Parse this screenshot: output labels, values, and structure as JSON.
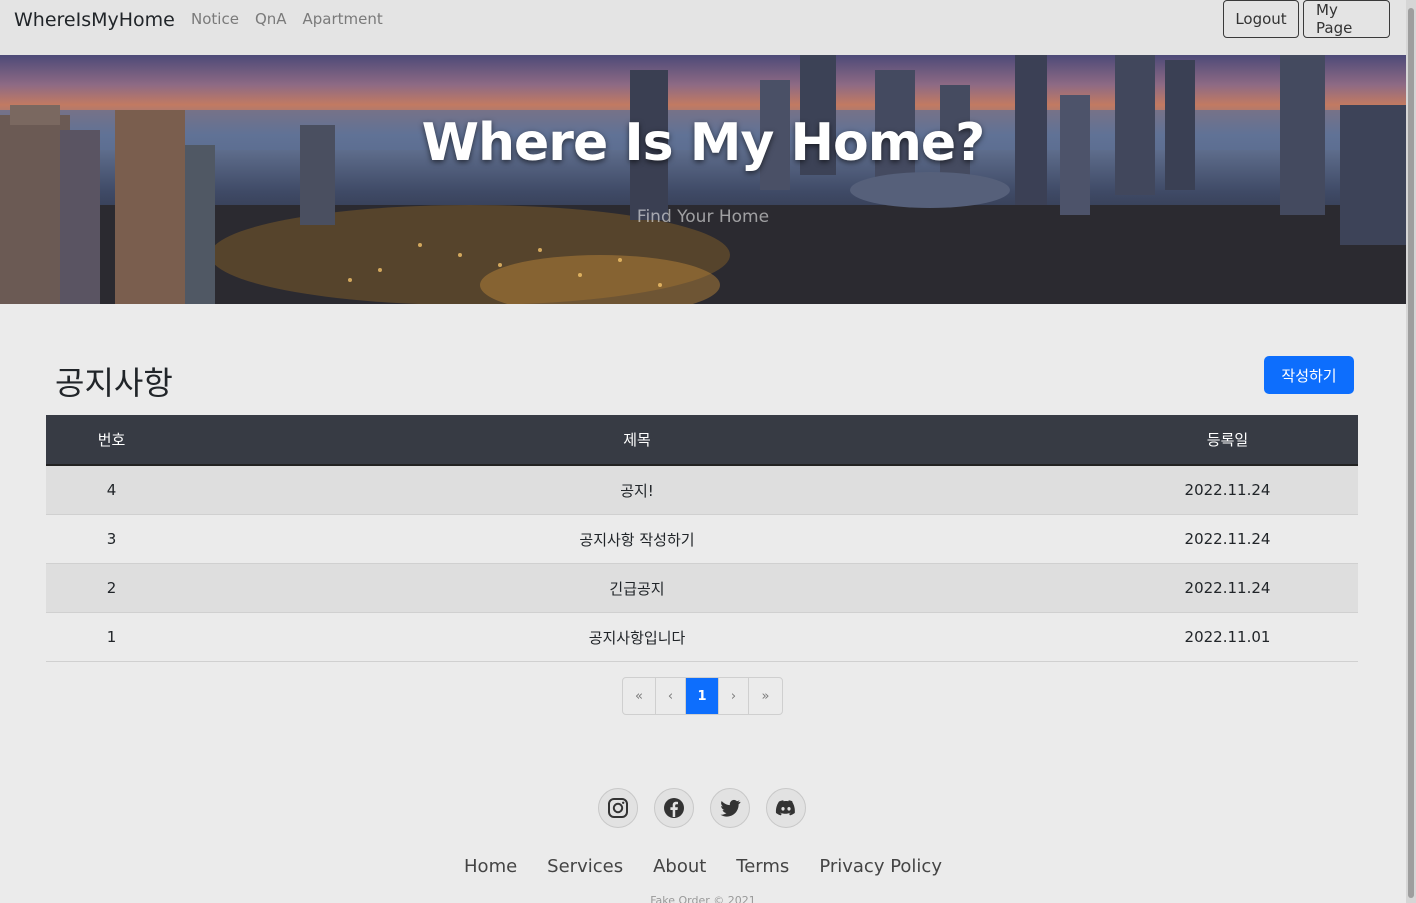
{
  "navbar": {
    "brand": "WhereIsMyHome",
    "links": [
      "Notice",
      "QnA",
      "Apartment"
    ],
    "logout_label": "Logout",
    "mypage_label": "My Page"
  },
  "hero": {
    "title": "Where Is My Home?",
    "subtitle": "Find Your Home"
  },
  "notice": {
    "heading": "공지사항",
    "write_label": "작성하기",
    "columns": [
      "번호",
      "제목",
      "등록일"
    ],
    "rows": [
      {
        "no": "4",
        "title": "공지!",
        "date": "2022.11.24"
      },
      {
        "no": "3",
        "title": "공지사항 작성하기",
        "date": "2022.11.24"
      },
      {
        "no": "2",
        "title": "긴급공지",
        "date": "2022.11.24"
      },
      {
        "no": "1",
        "title": "공지사항입니다",
        "date": "2022.11.01"
      }
    ]
  },
  "pagination": {
    "first": "«",
    "prev": "‹",
    "current": "1",
    "next": "›",
    "last": "»"
  },
  "footer": {
    "social_icons": [
      "instagram-icon",
      "facebook-icon",
      "twitter-icon",
      "discord-icon"
    ],
    "links": [
      "Home",
      "Services",
      "About",
      "Terms",
      "Privacy Policy"
    ],
    "copyright": "Fake Order © 2021"
  },
  "colors": {
    "accent": "#0d6efd",
    "table_header": "#373b44"
  }
}
